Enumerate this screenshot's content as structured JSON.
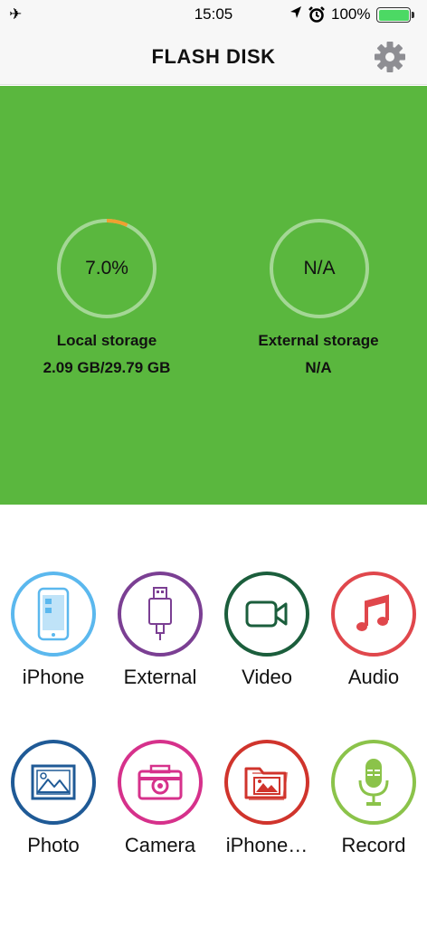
{
  "status_bar": {
    "airplane_icon": "airplane-icon",
    "time": "15:05",
    "location_icon": "location-arrow-icon",
    "alarm_icon": "alarm-clock-icon",
    "battery_text": "100%",
    "battery_level": 1.0,
    "battery_color": "#4cd964"
  },
  "nav": {
    "title": "FLASH DISK",
    "settings_icon": "gear-icon"
  },
  "storage": {
    "panel_color": "#5ab73e",
    "local": {
      "percent_label": "7.0%",
      "used_fraction": 0.07,
      "title": "Local storage",
      "value": "2.09 GB/29.79 GB"
    },
    "external": {
      "percent_label": "N/A",
      "title": "External storage",
      "value": "N/A"
    }
  },
  "tiles": [
    {
      "label": "iPhone",
      "icon": "phone-icon",
      "color": "#5bb8ee"
    },
    {
      "label": "External",
      "icon": "usb-drive-icon",
      "color": "#7b3f93"
    },
    {
      "label": "Video",
      "icon": "video-camera-icon",
      "color": "#1b5e3c"
    },
    {
      "label": "Audio",
      "icon": "music-note-icon",
      "color": "#e0474c"
    },
    {
      "label": "Photo",
      "icon": "picture-icon",
      "color": "#1f5a96"
    },
    {
      "label": "Camera",
      "icon": "camera-icon",
      "color": "#d6318b"
    },
    {
      "label": "iPhone…",
      "icon": "photo-folder-icon",
      "color": "#d0342c"
    },
    {
      "label": "Record",
      "icon": "microphone-icon",
      "color": "#8bc34a"
    }
  ]
}
